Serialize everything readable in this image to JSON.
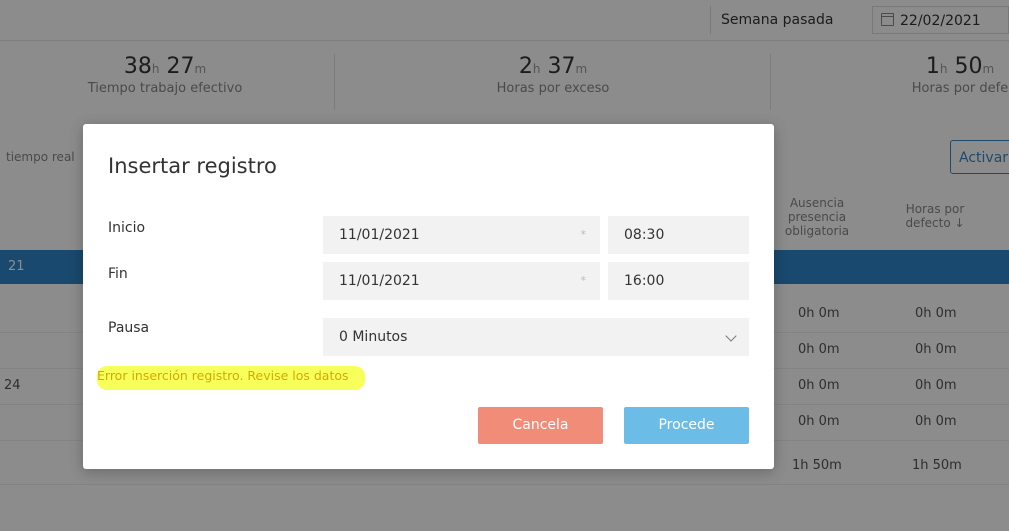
{
  "topbar": {
    "week_label": "Semana pasada",
    "date": "22/02/2021"
  },
  "stats": [
    {
      "hours": "38",
      "h_unit": "h",
      "minutes": "27",
      "m_unit": "m",
      "label": "Tiempo trabajo efectivo"
    },
    {
      "hours": "2",
      "h_unit": "h",
      "minutes": "37",
      "m_unit": "m",
      "label": "Horas por exceso"
    },
    {
      "hours": "1",
      "h_unit": "h",
      "minutes": "50",
      "m_unit": "m",
      "label": "Horas por defe"
    }
  ],
  "filter": {
    "partial_label": "tiempo real",
    "activate_button": "Activar"
  },
  "table": {
    "headers": [
      {
        "text": "Ausencia presencia obligatoria"
      },
      {
        "text": "Horas por defecto ↓"
      }
    ],
    "blue_row_label": "21",
    "row_lead": "24",
    "rows": [
      {
        "c1": "0h 0m",
        "c2": "0h 0m"
      },
      {
        "c1": "0h 0m",
        "c2": "0h 0m"
      },
      {
        "c1": "0h 0m",
        "c2": "0h 0m"
      },
      {
        "c1": "0h 0m",
        "c2": "0h 0m"
      },
      {
        "c1": "1h 50m",
        "c2": "1h 50m"
      }
    ]
  },
  "modal": {
    "title": "Insertar registro",
    "start_label": "Inicio",
    "start_date": "11/01/2021",
    "start_time": "08:30",
    "end_label": "Fin",
    "end_date": "11/01/2021",
    "end_time": "16:00",
    "pause_label": "Pausa",
    "pause_value": "0 Minutos",
    "error": "Error inserción registro. Revise los datos",
    "cancel_label": "Cancela",
    "proceed_label": "Procede",
    "colors": {
      "cancel": "#f08c78",
      "proceed": "#6cbce8",
      "highlight": "#f6ff3e",
      "error_text": "#d8a800"
    }
  }
}
